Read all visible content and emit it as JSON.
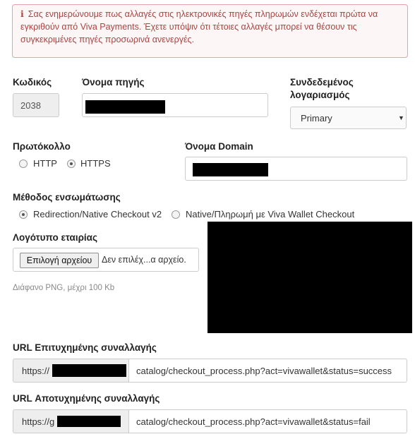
{
  "alert": {
    "icon": "info-icon",
    "color": "#a94442",
    "text": "Σας ενημερώνουμε πως αλλαγές στις ηλεκτρονικές πηγές πληρωμών ενδέχεται πρώτα να εγκριθούν από Viva Payments. Έχετε υπόψιν ότι τέτοιες αλλαγές μπορεί να θέσουν τις συγκεκριμένες πηγές προσωρινά ανενεργές."
  },
  "code": {
    "label": "Κωδικός",
    "value": "2038"
  },
  "source_name": {
    "label": "Όνομα πηγής"
  },
  "linked_account": {
    "label_line1": "Συνδεδεμένος",
    "label_line2": "λογαριασμός",
    "selected": "Primary"
  },
  "protocol": {
    "label": "Πρωτόκολλο",
    "options": [
      {
        "label": "HTTP",
        "checked": false
      },
      {
        "label": "HTTPS",
        "checked": true
      }
    ]
  },
  "domain": {
    "label": "Όνομα Domain"
  },
  "integration": {
    "label": "Μέθοδος ενσωμάτωσης",
    "options": [
      {
        "label": "Redirection/Native Checkout v2",
        "checked": true
      },
      {
        "label": "Native/Πληρωμή με Viva Wallet Checkout",
        "checked": false
      }
    ]
  },
  "logo": {
    "label": "Λογότυπο εταιρίας",
    "button": "Επιλογή αρχείου",
    "no_file": "Δεν επιλέχ...α αρχείο.",
    "help": "Διάφανο PNG, μέχρι 100 Kb"
  },
  "success_url": {
    "label": "URL Επιτυχημένης συναλλαγής",
    "prefix": "https://",
    "suffix": "catalog/checkout_process.php?act=vivawallet&status=success"
  },
  "fail_url": {
    "label": "URL Αποτυχημένης συναλλαγής",
    "prefix": "https://g",
    "suffix": "catalog/checkout_process.php?act=vivawallet&status=fail"
  }
}
